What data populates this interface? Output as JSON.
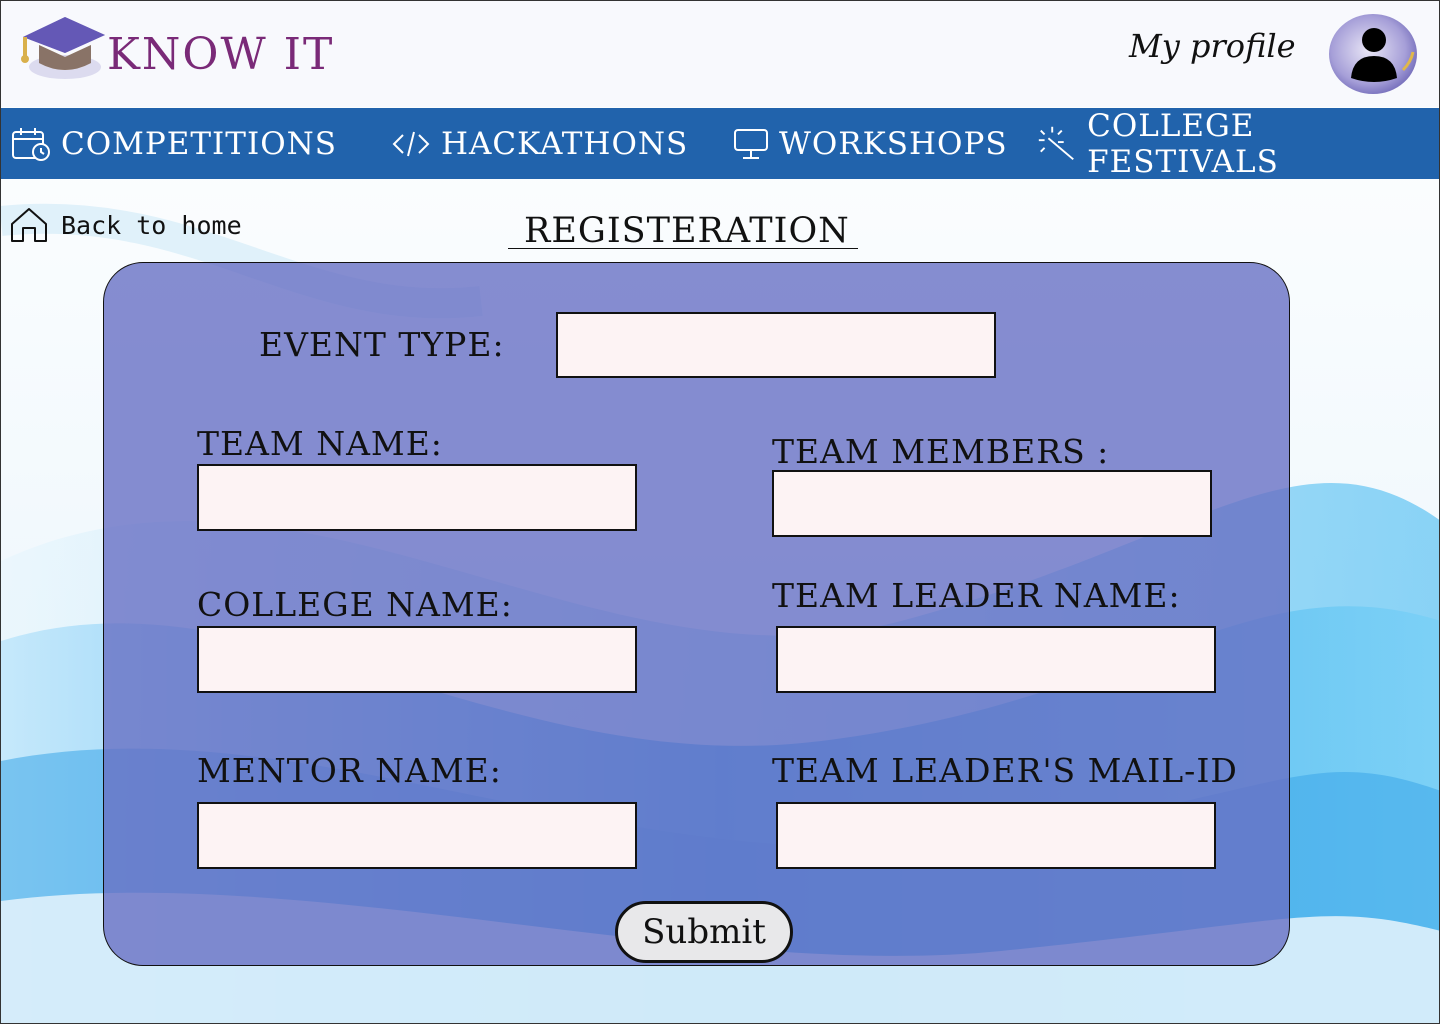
{
  "brand": {
    "name": "KNOW IT",
    "color": "#7a2a78",
    "logo_icon": "graduation-cap-icon"
  },
  "header": {
    "profile_label": "My profile",
    "avatar_icon": "user-avatar-icon"
  },
  "nav": {
    "background": "#2163ac",
    "items": [
      {
        "label": "COMPETITIONS",
        "icon": "calendar-clock-icon"
      },
      {
        "label": "HACKATHONS",
        "icon": "code-icon"
      },
      {
        "label": "WORKSHOPS",
        "icon": "presentation-icon"
      },
      {
        "label": "COLLEGE FESTIVALS",
        "icon": "sparkle-wand-icon"
      }
    ]
  },
  "back": {
    "label": "Back to home",
    "icon": "home-icon"
  },
  "page": {
    "title": "REGISTERATION"
  },
  "form": {
    "event_type": {
      "label": "EVENT TYPE:",
      "value": ""
    },
    "team_name": {
      "label": "TEAM NAME:",
      "value": ""
    },
    "team_members": {
      "label": "TEAM MEMBERS :",
      "value": ""
    },
    "college_name": {
      "label": "COLLEGE NAME:",
      "value": ""
    },
    "team_leader_name": {
      "label": "TEAM LEADER NAME:",
      "value": ""
    },
    "mentor_name": {
      "label": "MENTOR NAME:",
      "value": ""
    },
    "team_leader_mail": {
      "label": "TEAM LEADER'S MAIL-ID",
      "value": ""
    },
    "submit_label": "Submit"
  }
}
